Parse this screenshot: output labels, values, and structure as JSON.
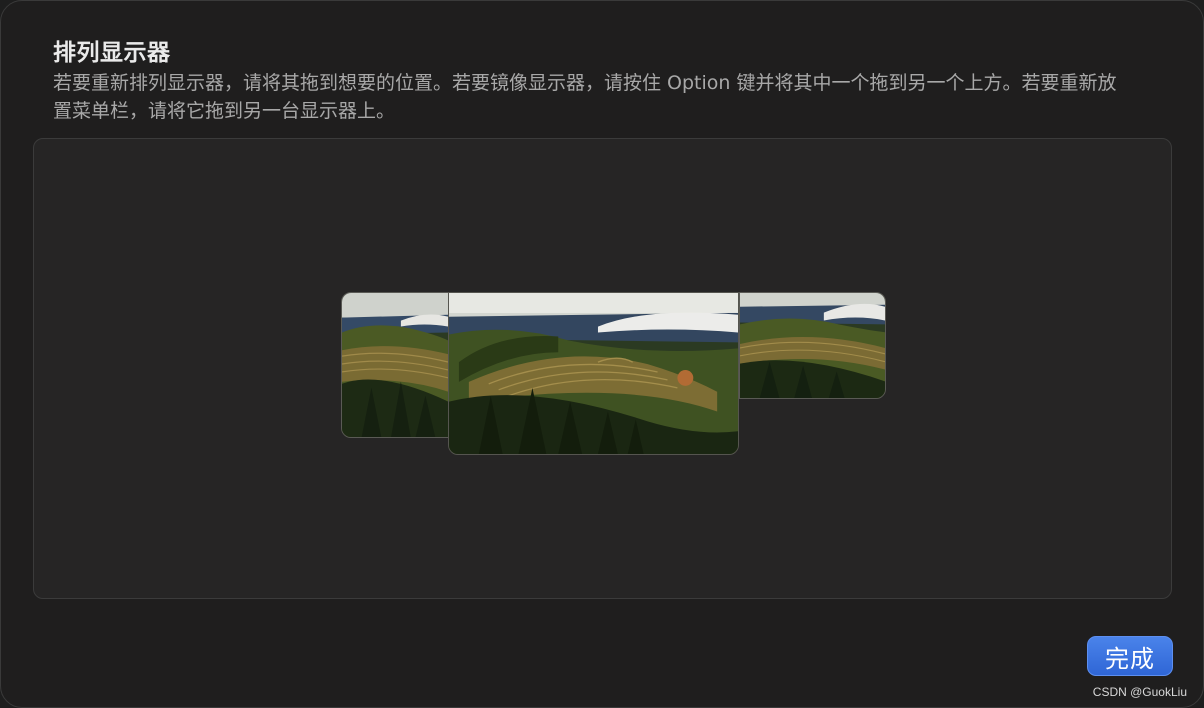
{
  "dialog": {
    "title": "排列显示器",
    "description": "若要重新排列显示器，请将其拖到想要的位置。若要镜像显示器，请按住 Option 键并将其中一个拖到另一个上方。若要重新放置菜单栏，请将它拖到另一台显示器上。",
    "done_label": "完成"
  },
  "displays": [
    {
      "name": "left-display",
      "wallpaper": "hills-landscape",
      "has_menubar": false
    },
    {
      "name": "main-display",
      "wallpaper": "hills-landscape",
      "has_menubar": true
    },
    {
      "name": "right-display",
      "wallpaper": "hills-landscape",
      "has_menubar": false
    }
  ],
  "colors": {
    "accent": "#3a74e0",
    "background": "#1f1e1e",
    "panel": "#262525"
  },
  "watermark": "CSDN @GuokLiu"
}
